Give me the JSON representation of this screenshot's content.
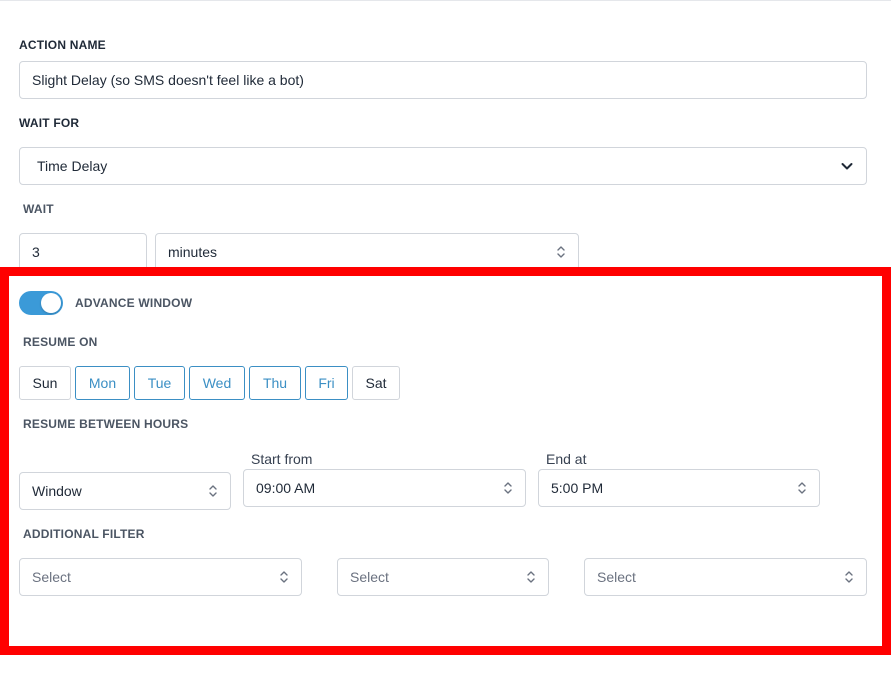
{
  "action_name": {
    "label": "ACTION NAME",
    "value": "Slight Delay (so SMS doesn't feel like a bot)"
  },
  "wait_for": {
    "label": "WAIT FOR",
    "value": "Time Delay"
  },
  "wait": {
    "label": "WAIT",
    "amount": "3",
    "unit": "minutes"
  },
  "advance_window": {
    "label": "ADVANCE WINDOW",
    "enabled": true
  },
  "resume_on": {
    "label": "RESUME ON",
    "days": [
      {
        "label": "Sun",
        "active": false
      },
      {
        "label": "Mon",
        "active": true
      },
      {
        "label": "Tue",
        "active": true
      },
      {
        "label": "Wed",
        "active": true
      },
      {
        "label": "Thu",
        "active": true
      },
      {
        "label": "Fri",
        "active": true
      },
      {
        "label": "Sat",
        "active": false
      }
    ]
  },
  "resume_between_hours": {
    "label": "RESUME BETWEEN HOURS",
    "mode": "Window",
    "start_label": "Start from",
    "start_value": "09:00 AM",
    "end_label": "End at",
    "end_value": "5:00 PM"
  },
  "additional_filter": {
    "label": "ADDITIONAL FILTER",
    "selects": [
      "Select",
      "Select",
      "Select"
    ]
  },
  "colors": {
    "accent": "#3b8fc4",
    "toggle_on": "#3b9ad8",
    "highlight": "#ff0000"
  },
  "icons": {
    "dropdown": "chevron-down-icon",
    "stepper": "up-down-arrows-icon"
  }
}
